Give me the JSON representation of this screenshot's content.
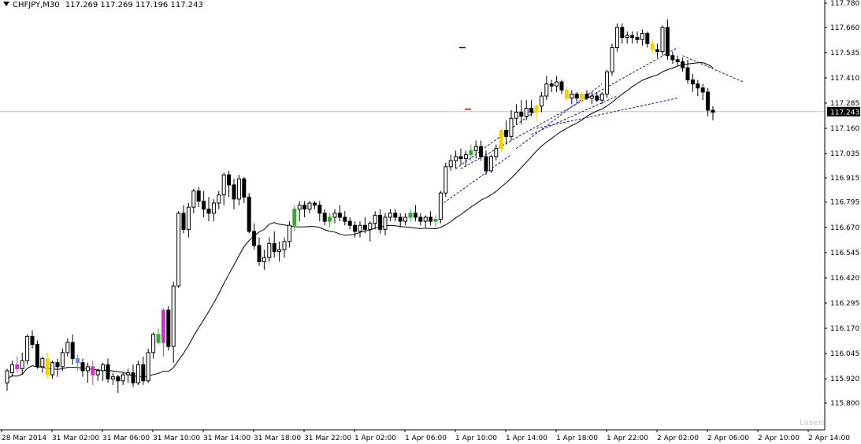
{
  "header": {
    "symbol": "CHFJPY,M30",
    "open": "117.269",
    "high": "117.269",
    "low": "117.196",
    "close": "117.243"
  },
  "colors": {
    "background": "#ffffff",
    "candle_up_fill": "#ffffff",
    "candle_down_fill": "#000000",
    "candle_border": "#000000",
    "ma_line": "#000000",
    "trend_lines": "#1010c0",
    "highlight_yellow": "#f5d000",
    "highlight_magenta": "#cc33cc",
    "highlight_green": "#33aa33",
    "highlight_blue": "#6688dd",
    "bid_line": "#c0c0c0",
    "price_label_bg": "#000000",
    "marker_blue": "#0000cc",
    "marker_red": "#dd0000"
  },
  "current_price_label": "117.243",
  "watermark": "Labels",
  "chart_data": {
    "type": "candlestick",
    "title": "CHFJPY,M30",
    "y_ticks": [
      "117.780",
      "117.660",
      "117.535",
      "117.410",
      "117.285",
      "117.160",
      "117.035",
      "116.915",
      "116.795",
      "116.670",
      "116.545",
      "116.420",
      "116.295",
      "116.170",
      "116.045",
      "115.920",
      "115.800"
    ],
    "ylim": [
      115.8,
      117.78
    ],
    "x_ticks": [
      "28 Mar 2014",
      "31 Mar 02:00",
      "31 Mar 06:00",
      "31 Mar 10:00",
      "31 Mar 14:00",
      "31 Mar 18:00",
      "31 Mar 22:00",
      "1 Apr 02:00",
      "1 Apr 06:00",
      "1 Apr 10:00",
      "1 Apr 14:00",
      "1 Apr 18:00",
      "1 Apr 22:00",
      "2 Apr 02:00",
      "2 Apr 06:00",
      "2 Apr 10:00",
      "2 Apr 14:00"
    ],
    "current_price": 117.243,
    "grid": false,
    "candles": [
      [
        115.9,
        115.97,
        115.86,
        115.96
      ],
      [
        115.95,
        116.01,
        115.93,
        115.99
      ],
      [
        115.99,
        116.03,
        115.95,
        115.97
      ],
      [
        115.97,
        116.05,
        115.94,
        116.01
      ],
      [
        116.01,
        116.14,
        115.99,
        116.13
      ],
      [
        116.13,
        116.16,
        116.07,
        116.09
      ],
      [
        116.09,
        116.11,
        115.97,
        115.98
      ],
      [
        115.98,
        116.03,
        115.95,
        116.02
      ],
      [
        116.02,
        116.05,
        115.92,
        115.94
      ],
      [
        115.94,
        116.01,
        115.92,
        116.0
      ],
      [
        116.0,
        116.02,
        115.93,
        115.98
      ],
      [
        115.98,
        116.07,
        115.96,
        116.05
      ],
      [
        116.05,
        116.12,
        116.03,
        116.1
      ],
      [
        116.1,
        116.14,
        115.99,
        116.02
      ],
      [
        116.02,
        116.04,
        115.96,
        116.0
      ],
      [
        116.0,
        116.02,
        115.93,
        115.96
      ],
      [
        115.96,
        116.0,
        115.9,
        115.98
      ],
      [
        115.98,
        116.01,
        115.89,
        115.94
      ],
      [
        115.94,
        115.97,
        115.91,
        115.96
      ],
      [
        115.96,
        116.0,
        115.91,
        115.99
      ],
      [
        115.99,
        116.02,
        115.9,
        115.92
      ],
      [
        115.92,
        115.95,
        115.89,
        115.93
      ],
      [
        115.93,
        115.94,
        115.85,
        115.91
      ],
      [
        115.91,
        115.95,
        115.89,
        115.94
      ],
      [
        115.94,
        115.97,
        115.9,
        115.95
      ],
      [
        115.95,
        115.99,
        115.88,
        115.9
      ],
      [
        115.9,
        116.01,
        115.89,
        115.99
      ],
      [
        115.99,
        116.03,
        115.89,
        115.91
      ],
      [
        115.91,
        116.07,
        115.9,
        116.05
      ],
      [
        116.05,
        116.15,
        116.02,
        116.14
      ],
      [
        116.14,
        116.17,
        116.09,
        116.1
      ],
      [
        116.1,
        116.27,
        116.03,
        116.26
      ],
      [
        116.26,
        116.28,
        116.06,
        116.08
      ],
      [
        116.08,
        116.4,
        116.0,
        116.38
      ],
      [
        116.38,
        116.75,
        116.37,
        116.74
      ],
      [
        116.74,
        116.78,
        116.64,
        116.66
      ],
      [
        116.66,
        116.79,
        116.62,
        116.77
      ],
      [
        116.77,
        116.86,
        116.74,
        116.85
      ],
      [
        116.85,
        116.87,
        116.77,
        116.8
      ],
      [
        116.8,
        116.85,
        116.72,
        116.76
      ],
      [
        116.76,
        116.82,
        116.7,
        116.74
      ],
      [
        116.74,
        116.81,
        116.7,
        116.79
      ],
      [
        116.79,
        116.85,
        116.76,
        116.83
      ],
      [
        116.83,
        116.94,
        116.78,
        116.93
      ],
      [
        116.93,
        116.95,
        116.82,
        116.88
      ],
      [
        116.88,
        116.91,
        116.76,
        116.81
      ],
      [
        116.81,
        116.93,
        116.78,
        116.91
      ],
      [
        116.91,
        116.92,
        116.79,
        116.82
      ],
      [
        116.82,
        116.84,
        116.64,
        116.65
      ],
      [
        116.65,
        116.69,
        116.56,
        116.58
      ],
      [
        116.58,
        116.62,
        116.48,
        116.5
      ],
      [
        116.5,
        116.56,
        116.46,
        116.52
      ],
      [
        116.52,
        116.62,
        116.5,
        116.59
      ],
      [
        116.59,
        116.65,
        116.52,
        116.55
      ],
      [
        116.55,
        116.6,
        116.5,
        116.56
      ],
      [
        116.56,
        116.62,
        116.52,
        116.6
      ],
      [
        116.6,
        116.7,
        116.57,
        116.68
      ],
      [
        116.68,
        116.78,
        116.65,
        116.76
      ],
      [
        116.76,
        116.8,
        116.7,
        116.78
      ],
      [
        116.78,
        116.8,
        116.72,
        116.76
      ],
      [
        116.76,
        116.8,
        116.74,
        116.79
      ],
      [
        116.79,
        116.8,
        116.76,
        116.78
      ],
      [
        116.78,
        116.8,
        116.7,
        116.74
      ],
      [
        116.74,
        116.76,
        116.68,
        116.7
      ],
      [
        116.7,
        116.74,
        116.67,
        116.72
      ],
      [
        116.72,
        116.76,
        116.69,
        116.74
      ],
      [
        116.74,
        116.78,
        116.7,
        116.72
      ],
      [
        116.72,
        116.75,
        116.68,
        116.7
      ],
      [
        116.7,
        116.72,
        116.66,
        116.68
      ],
      [
        116.68,
        116.7,
        116.62,
        116.65
      ],
      [
        116.65,
        116.7,
        116.62,
        116.68
      ],
      [
        116.68,
        116.72,
        116.64,
        116.66
      ],
      [
        116.66,
        116.7,
        116.6,
        116.69
      ],
      [
        116.69,
        116.75,
        116.66,
        116.73
      ],
      [
        116.73,
        116.76,
        116.64,
        116.66
      ],
      [
        116.66,
        116.74,
        116.63,
        116.72
      ],
      [
        116.72,
        116.76,
        116.7,
        116.74
      ],
      [
        116.74,
        116.76,
        116.7,
        116.72
      ],
      [
        116.72,
        116.74,
        116.67,
        116.7
      ],
      [
        116.7,
        116.74,
        116.68,
        116.72
      ],
      [
        116.72,
        116.76,
        116.7,
        116.74
      ],
      [
        116.74,
        116.78,
        116.7,
        116.72
      ],
      [
        116.72,
        116.74,
        116.68,
        116.7
      ],
      [
        116.7,
        116.73,
        116.67,
        116.72
      ],
      [
        116.72,
        116.75,
        116.68,
        116.7
      ],
      [
        116.7,
        116.73,
        116.67,
        116.71
      ],
      [
        116.71,
        116.85,
        116.69,
        116.84
      ],
      [
        116.84,
        116.99,
        116.82,
        116.97
      ],
      [
        116.97,
        117.03,
        116.95,
        117.0
      ],
      [
        117.0,
        117.05,
        116.96,
        117.02
      ],
      [
        117.02,
        117.06,
        116.98,
        117.01
      ],
      [
        117.01,
        117.05,
        116.97,
        117.03
      ],
      [
        117.03,
        117.08,
        117.0,
        117.05
      ],
      [
        117.05,
        117.1,
        117.01,
        117.07
      ],
      [
        117.07,
        117.1,
        117.0,
        117.02
      ],
      [
        117.02,
        117.05,
        116.93,
        116.95
      ],
      [
        116.95,
        117.03,
        116.94,
        117.02
      ],
      [
        117.02,
        117.08,
        117.0,
        117.06
      ],
      [
        117.06,
        117.16,
        117.04,
        117.15
      ],
      [
        117.15,
        117.2,
        117.08,
        117.12
      ],
      [
        117.12,
        117.25,
        117.1,
        117.21
      ],
      [
        117.21,
        117.28,
        117.18,
        117.24
      ],
      [
        117.24,
        117.3,
        117.18,
        117.22
      ],
      [
        117.22,
        117.3,
        117.2,
        117.26
      ],
      [
        117.26,
        117.3,
        117.22,
        117.24
      ],
      [
        117.24,
        117.28,
        117.2,
        117.27
      ],
      [
        117.27,
        117.34,
        117.24,
        117.32
      ],
      [
        117.32,
        117.42,
        117.3,
        117.38
      ],
      [
        117.38,
        117.4,
        117.34,
        117.37
      ],
      [
        117.37,
        117.42,
        117.34,
        117.39
      ],
      [
        117.39,
        117.4,
        117.33,
        117.35
      ],
      [
        117.35,
        117.37,
        117.29,
        117.31
      ],
      [
        117.31,
        117.35,
        117.28,
        117.33
      ],
      [
        117.33,
        117.34,
        117.29,
        117.31
      ],
      [
        117.31,
        117.34,
        117.29,
        117.33
      ],
      [
        117.33,
        117.35,
        117.3,
        117.31
      ],
      [
        117.31,
        117.34,
        117.28,
        117.32
      ],
      [
        117.32,
        117.34,
        117.29,
        117.3
      ],
      [
        117.3,
        117.34,
        117.28,
        117.33
      ],
      [
        117.33,
        117.45,
        117.31,
        117.44
      ],
      [
        117.44,
        117.58,
        117.42,
        117.56
      ],
      [
        117.56,
        117.68,
        117.54,
        117.66
      ],
      [
        117.66,
        117.68,
        117.58,
        117.61
      ],
      [
        117.61,
        117.64,
        117.58,
        117.62
      ],
      [
        117.62,
        117.64,
        117.58,
        117.61
      ],
      [
        117.61,
        117.64,
        117.58,
        117.6
      ],
      [
        117.6,
        117.65,
        117.57,
        117.63
      ],
      [
        117.63,
        117.64,
        117.56,
        117.58
      ],
      [
        117.58,
        117.6,
        117.53,
        117.55
      ],
      [
        117.55,
        117.58,
        117.51,
        117.54
      ],
      [
        117.54,
        117.67,
        117.52,
        117.66
      ],
      [
        117.66,
        117.7,
        117.5,
        117.52
      ],
      [
        117.52,
        117.54,
        117.48,
        117.5
      ],
      [
        117.5,
        117.52,
        117.47,
        117.49
      ],
      [
        117.49,
        117.51,
        117.44,
        117.46
      ],
      [
        117.46,
        117.5,
        117.38,
        117.4
      ],
      [
        117.4,
        117.43,
        117.34,
        117.38
      ],
      [
        117.38,
        117.4,
        117.32,
        117.36
      ],
      [
        117.36,
        117.38,
        117.3,
        117.34
      ],
      [
        117.34,
        117.36,
        117.22,
        117.25
      ],
      [
        117.25,
        117.27,
        117.2,
        117.24
      ]
    ]
  }
}
